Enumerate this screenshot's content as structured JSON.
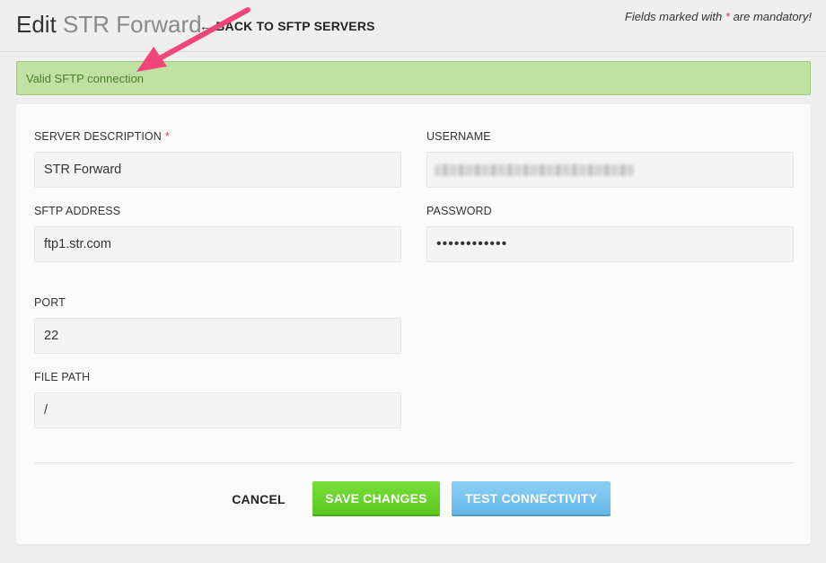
{
  "header": {
    "title_verb": "Edit",
    "title_subject": "STR Forward",
    "back_arrow": "←",
    "back_label": "BACK TO SFTP SERVERS",
    "mandatory_prefix": "Fields marked with",
    "mandatory_star": "*",
    "mandatory_suffix": "are mandatory!"
  },
  "alert": {
    "message": "Valid SFTP connection",
    "color": "#bfe1a2"
  },
  "form": {
    "server_description": {
      "label": "SERVER DESCRIPTION",
      "required_mark": "*",
      "value": "STR Forward"
    },
    "username": {
      "label": "USERNAME",
      "value": ""
    },
    "sftp_address": {
      "label": "SFTP ADDRESS",
      "value": "ftp1.str.com"
    },
    "password": {
      "label": "PASSWORD",
      "value": "••••••••••••"
    },
    "port": {
      "label": "PORT",
      "value": "22"
    },
    "file_path": {
      "label": "FILE PATH",
      "value": "/"
    }
  },
  "actions": {
    "cancel_label": "CANCEL",
    "save_label": "SAVE CHANGES",
    "test_label": "TEST CONNECTIVITY"
  },
  "colors": {
    "required": "#e0354b",
    "save_button": "#5cc81f",
    "test_button": "#63b6e6",
    "annotation_arrow": "#f0457a"
  }
}
